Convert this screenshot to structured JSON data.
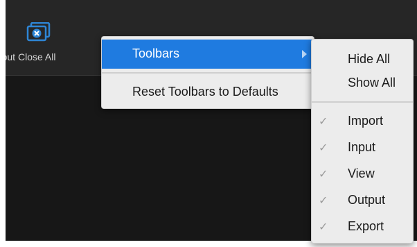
{
  "toolbar": {
    "truncated_label": "Output",
    "close_all_label": "Close All"
  },
  "menu": {
    "items": [
      {
        "label": "Toolbars",
        "has_submenu": true,
        "highlighted": true
      },
      {
        "label": "Reset Toolbars to Defaults"
      }
    ]
  },
  "submenu": {
    "actions": [
      {
        "label": "Hide All"
      },
      {
        "label": "Show All"
      }
    ],
    "toolbars": [
      {
        "label": "Import",
        "checked": true
      },
      {
        "label": "Input",
        "checked": true
      },
      {
        "label": "View",
        "checked": true
      },
      {
        "label": "Output",
        "checked": true
      },
      {
        "label": "Export",
        "checked": true
      }
    ]
  },
  "icons": {
    "close_all": "close-all-icon",
    "submenu_arrow": "chevron-right-icon",
    "check": "check-icon"
  },
  "colors": {
    "toolbar_bg": "#262626",
    "workspace_bg": "#171717",
    "menu_bg": "#ececec",
    "highlight": "#1f7be0",
    "icon_blue": "#2e86d6"
  }
}
